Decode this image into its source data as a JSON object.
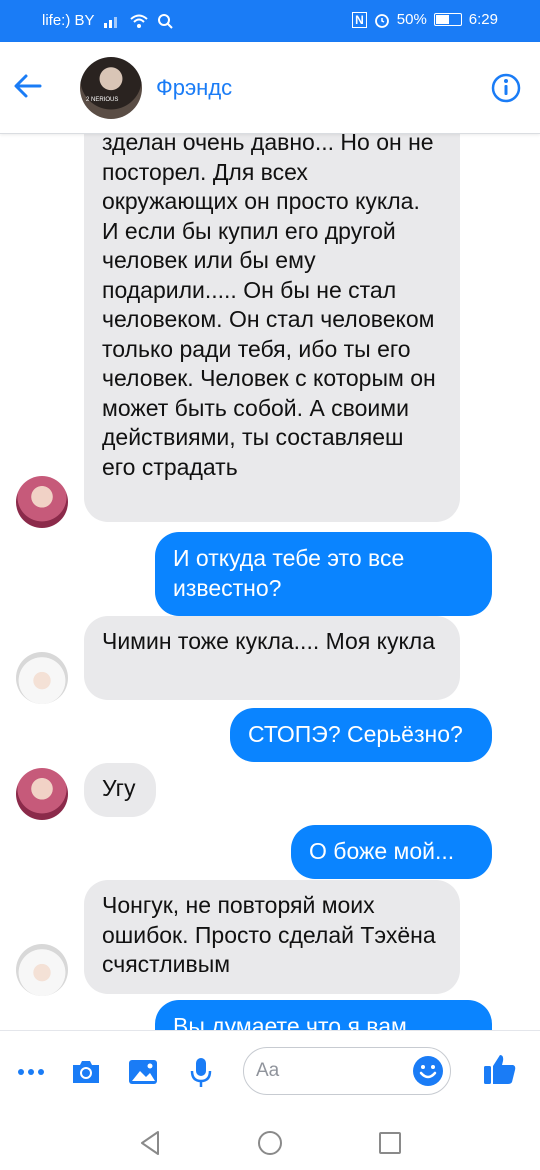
{
  "status_bar": {
    "carrier": "life:) BY",
    "nfc": "N",
    "battery_percent": "50%",
    "time": "6:29"
  },
  "header": {
    "contact_name": "Фрэндс",
    "avatar_caption": "2 NERIOUS"
  },
  "messages": [
    {
      "side": "incoming",
      "avatar": "pink-hair",
      "text": "зделан очень давно... Но он не посторел. Для всех окружающих он просто кукла. И если бы купил его другой человек или бы ему подарили..... Он бы не стал человеком. Он стал человеком только ради тебя, ибо ты его человек. Человек с которым он может быть собой. А своими действиями, ты составляеш его  страдать"
    },
    {
      "side": "outgoing",
      "text": "И откуда тебе это все известно?"
    },
    {
      "side": "incoming",
      "avatar": "white-hood",
      "text": "Чимин тоже кукла.... Моя кукла"
    },
    {
      "side": "outgoing",
      "text": "СТОПЭ? Серьёзно?"
    },
    {
      "side": "incoming",
      "avatar": "pink-hair",
      "text": "Угу"
    },
    {
      "side": "outgoing",
      "text": "О боже мой..."
    },
    {
      "side": "incoming",
      "avatar": "white-hood",
      "text": "Чонгук, не повторяй моих ошибок. Просто сделай Тэхёна счястливым"
    },
    {
      "side": "outgoing",
      "text": "Вы думаете что я вам..."
    }
  ],
  "composer": {
    "placeholder": "Aa",
    "icons": [
      "more-icon",
      "camera-icon",
      "gallery-icon",
      "microphone-icon",
      "emoji-icon",
      "like-icon"
    ]
  },
  "colors": {
    "accent": "#1a7cf6",
    "outgoing_bubble": "#0a84ff",
    "incoming_bubble": "#e9e9eb"
  }
}
